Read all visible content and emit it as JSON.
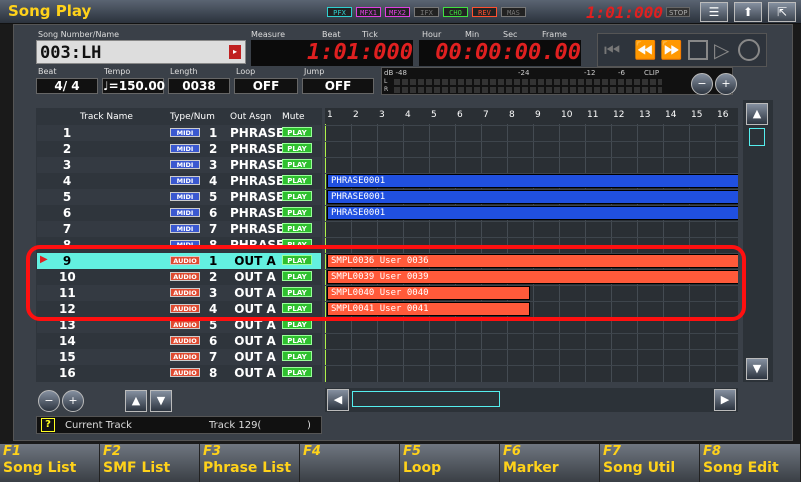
{
  "app": {
    "title": "Song Play"
  },
  "fx_indicators": [
    {
      "label": "PFX",
      "color": "#2fd0d0"
    },
    {
      "label": "MFX1",
      "color": "#e040e0"
    },
    {
      "label": "MFX2",
      "color": "#e040e0"
    },
    {
      "label": "IFX",
      "color": "#777777"
    },
    {
      "label": "CHO",
      "color": "#40e040"
    },
    {
      "label": "REV",
      "color": "#ff5030"
    },
    {
      "label": "MAS",
      "color": "#777777"
    }
  ],
  "top_counter": {
    "value": "1:01:000",
    "status": "STOP"
  },
  "header": {
    "song_label": "Song Number/Name",
    "song_value": "003:LH",
    "measure_label": "Measure",
    "beat_label": "Beat",
    "tick_label": "Tick",
    "measure_value": "1:01:000",
    "hour_label": "Hour",
    "min_label": "Min",
    "sec_label": "Sec",
    "frame_label": "Frame",
    "time_value": "00:00:00.00",
    "beat": {
      "label": "Beat",
      "value": "4/ 4"
    },
    "tempo": {
      "label": "Tempo",
      "value": "♩=150.00"
    },
    "length": {
      "label": "Length",
      "value": "0038"
    },
    "loop": {
      "label": "Loop",
      "value": "OFF"
    },
    "jump": {
      "label": "Jump",
      "value": "OFF"
    }
  },
  "meter": {
    "scale": [
      "dB -48",
      "-24",
      "-12",
      "-6",
      "CLIP"
    ],
    "channels": [
      "L",
      "R"
    ]
  },
  "columns": {
    "track_name": "Track Name",
    "type_num": "Type/Num",
    "out_asgn": "Out Asgn",
    "mute": "Mute"
  },
  "tracks": [
    {
      "num": "1",
      "type": "MIDI",
      "sub": "1",
      "out": "PHRASE",
      "mute": "PLAY"
    },
    {
      "num": "2",
      "type": "MIDI",
      "sub": "2",
      "out": "PHRASE",
      "mute": "PLAY"
    },
    {
      "num": "3",
      "type": "MIDI",
      "sub": "3",
      "out": "PHRASE",
      "mute": "PLAY"
    },
    {
      "num": "4",
      "type": "MIDI",
      "sub": "4",
      "out": "PHRASE",
      "mute": "PLAY"
    },
    {
      "num": "5",
      "type": "MIDI",
      "sub": "5",
      "out": "PHRASE",
      "mute": "PLAY"
    },
    {
      "num": "6",
      "type": "MIDI",
      "sub": "6",
      "out": "PHRASE",
      "mute": "PLAY"
    },
    {
      "num": "7",
      "type": "MIDI",
      "sub": "7",
      "out": "PHRASE",
      "mute": "PLAY"
    },
    {
      "num": "8",
      "type": "MIDI",
      "sub": "8",
      "out": "PHRASE",
      "mute": "PLAY"
    },
    {
      "num": "9",
      "type": "AUDIO",
      "sub": "1",
      "out": "OUT A",
      "mute": "PLAY"
    },
    {
      "num": "10",
      "type": "AUDIO",
      "sub": "2",
      "out": "OUT A",
      "mute": "PLAY"
    },
    {
      "num": "11",
      "type": "AUDIO",
      "sub": "3",
      "out": "OUT A",
      "mute": "PLAY"
    },
    {
      "num": "12",
      "type": "AUDIO",
      "sub": "4",
      "out": "OUT A",
      "mute": "PLAY"
    },
    {
      "num": "13",
      "type": "AUDIO",
      "sub": "5",
      "out": "OUT A",
      "mute": "PLAY"
    },
    {
      "num": "14",
      "type": "AUDIO",
      "sub": "6",
      "out": "OUT A",
      "mute": "PLAY"
    },
    {
      "num": "15",
      "type": "AUDIO",
      "sub": "7",
      "out": "OUT A",
      "mute": "PLAY"
    },
    {
      "num": "16",
      "type": "AUDIO",
      "sub": "8",
      "out": "OUT A",
      "mute": "PLAY"
    }
  ],
  "measures": [
    "1",
    "2",
    "3",
    "4",
    "5",
    "6",
    "7",
    "8",
    "9",
    "10",
    "11",
    "12",
    "13",
    "14",
    "15",
    "16"
  ],
  "phrases": [
    {
      "track": 4,
      "label": "PHRASE0001",
      "color": "#2050e0"
    },
    {
      "track": 5,
      "label": "PHRASE0001",
      "color": "#2050e0"
    },
    {
      "track": 6,
      "label": "PHRASE0001",
      "color": "#2050e0"
    },
    {
      "track": 9,
      "label": "SMPL0036 User 0036",
      "color": "#ff5a3a"
    },
    {
      "track": 10,
      "label": "SMPL0039 User 0039",
      "color": "#ff5a3a"
    },
    {
      "track": 11,
      "label": "SMPL0040 User 0040",
      "color": "#ff5a3a"
    },
    {
      "track": 12,
      "label": "SMPL0041 User 0041",
      "color": "#ff5a3a"
    }
  ],
  "status": {
    "label": "Current Track",
    "value": "Track 129(",
    "suffix": ")"
  },
  "function_keys": [
    {
      "key": "F1",
      "label": "Song List"
    },
    {
      "key": "F2",
      "label": "SMF List"
    },
    {
      "key": "F3",
      "label": "Phrase List"
    },
    {
      "key": "F4",
      "label": ""
    },
    {
      "key": "F5",
      "label": "Loop"
    },
    {
      "key": "F6",
      "label": "Marker"
    },
    {
      "key": "F7",
      "label": "Song Util"
    },
    {
      "key": "F8",
      "label": "Song Edit"
    }
  ],
  "colors": {
    "accent": "#ffd21a",
    "led": "#e02020",
    "selected_row": "#63f0e0",
    "highlight_box": "#ff1010"
  }
}
